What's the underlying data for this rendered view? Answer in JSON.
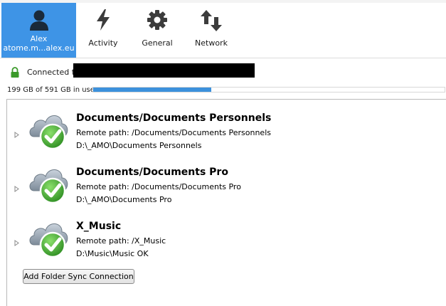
{
  "toolbar": {
    "account": {
      "name": "Alex",
      "server": "atome.m...alex.eu",
      "icon": "user-icon"
    },
    "activity": {
      "label": "Activity",
      "icon": "lightning-icon"
    },
    "general": {
      "label": "General",
      "icon": "gear-icon"
    },
    "network": {
      "label": "Network",
      "icon": "network-arrows-icon"
    }
  },
  "connection": {
    "status_text": "Connected to",
    "icon": "lock-icon"
  },
  "quota": {
    "text": "199 GB of 591 GB in use",
    "used_gb": 199,
    "total_gb": 591
  },
  "folders": [
    {
      "name": "Documents/Documents Personnels",
      "remote": "Remote path: /Documents/Documents Personnels",
      "local": "D:\\_AMO\\Documents Personnels",
      "icon": "cloud-check-icon"
    },
    {
      "name": "Documents/Documents Pro",
      "remote": "Remote path: /Documents/Documents Pro",
      "local": "D:\\_AMO\\Documents Pro",
      "icon": "cloud-check-icon"
    },
    {
      "name": "X_Music",
      "remote": "Remote path: /X_Music",
      "local": "D:\\Music\\Music OK",
      "icon": "cloud-check-icon"
    }
  ],
  "add_button": {
    "label": "Add Folder Sync Connection"
  },
  "colors": {
    "accent": "#3e94e6",
    "quota_fill": "#3c91dc",
    "check_green": "#3aa62e"
  }
}
